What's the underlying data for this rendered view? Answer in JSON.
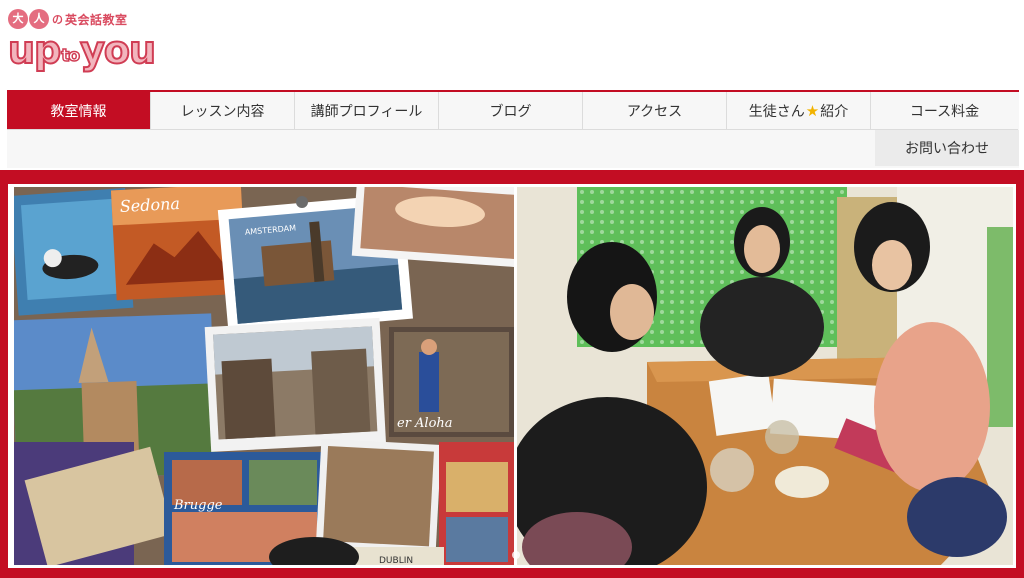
{
  "brand": {
    "logo_circle_1": "大",
    "logo_circle_2": "人",
    "logo_no": "の",
    "logo_sub": "英会話教室",
    "logo_main_left": "up",
    "logo_main_to": "to",
    "logo_main_right": "you",
    "colors": {
      "accent_red": "#c30d23",
      "logo_pink": "#f2b5bd",
      "logo_stroke": "#d03d54"
    }
  },
  "nav": {
    "items": [
      {
        "label": "教室情報",
        "active": true
      },
      {
        "label": "レッスン内容"
      },
      {
        "label": "講師プロフィール"
      },
      {
        "label": "ブログ"
      },
      {
        "label": "アクセス"
      },
      {
        "label_before": "生徒さん",
        "star": "★",
        "label_after": "紹介"
      },
      {
        "label": "コース料金"
      }
    ],
    "contact_label": "お問い合わせ"
  },
  "hero": {
    "left_image": "postcards-collage",
    "right_image": "lesson-scene-photo",
    "postcards": {
      "sedona": "Sedona",
      "amsterdam": "AMSTERDAM",
      "brugge": "Brugge",
      "aloha": "er Aloha",
      "dublin": "DUBLIN"
    }
  }
}
